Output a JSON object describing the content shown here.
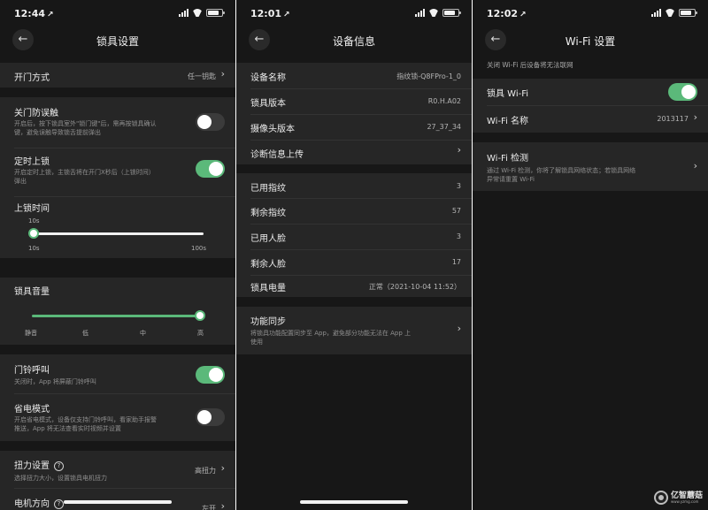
{
  "panel_lock_settings": {
    "status": {
      "time": "12:44",
      "location_arrow": "↗"
    },
    "nav": {
      "back": "←",
      "title": "锁具设置"
    },
    "unlock_method": {
      "label": "开门方式",
      "value": "任一钥匙"
    },
    "anti_mistouch": {
      "label": "关门防误触",
      "desc_line1": "开启后，按下锁具室外\"锁门键\"后，需再按锁具确认",
      "desc_line2": "键，避免误触导致锁舌提前弹出",
      "enabled": false
    },
    "timed_lock": {
      "label": "定时上锁",
      "desc_line1": "开启定时上锁，主锁舌将在开门X秒后（上锁时间）",
      "desc_line2": "弹出",
      "enabled": true
    },
    "lock_time": {
      "label": "上锁时间",
      "current": "10s",
      "min_label": "10s",
      "max_label": "100s",
      "fraction": 0.0
    },
    "volume": {
      "label": "锁具音量",
      "ticks": [
        "静音",
        "低",
        "中",
        "高"
      ],
      "fraction": 1.0
    },
    "doorbell": {
      "label": "门铃呼叫",
      "desc": "关闭时，App 将屏蔽门铃呼叫",
      "enabled": true
    },
    "power_saving": {
      "label": "省电模式",
      "desc_line1": "开启省电模式，设备仅支持门铃呼叫，看家助手报警",
      "desc_line2": "推送，App 将无法查看实时视频并设置",
      "enabled": false
    },
    "torque": {
      "label": "扭力设置",
      "help": "?",
      "desc": "选择扭力大小，设置锁具电机扭力",
      "value": "高扭力"
    },
    "motor_direction": {
      "label": "电机方向",
      "help": "?",
      "value": "左开"
    }
  },
  "panel_device_info": {
    "status": {
      "time": "12:01",
      "location_arrow": "↗"
    },
    "nav": {
      "back": "←",
      "title": "设备信息"
    },
    "rows_group1": [
      {
        "label": "设备名称",
        "value": "指纹锁-Q8FPro-1_0"
      },
      {
        "label": "锁具版本",
        "value": "R0.H.A02"
      },
      {
        "label": "摄像头版本",
        "value": "27_37_34"
      },
      {
        "label": "诊断信息上传",
        "value": ""
      }
    ],
    "rows_group2": [
      {
        "label": "已用指纹",
        "value": "3"
      },
      {
        "label": "剩余指纹",
        "value": "57"
      },
      {
        "label": "已用人脸",
        "value": "3"
      },
      {
        "label": "剩余人脸",
        "value": "17"
      },
      {
        "label": "锁具电量",
        "value": "正常（2021-10-04 11:52）"
      }
    ],
    "sync": {
      "label": "功能同步",
      "desc_line1": "将锁具功能配置同步至 App，避免部分功能无法在 App 上",
      "desc_line2": "使用"
    }
  },
  "panel_wifi": {
    "status": {
      "time": "12:02",
      "location_arrow": "↗"
    },
    "nav": {
      "back": "←",
      "title": "Wi-Fi 设置"
    },
    "note": "关闭 Wi-Fi 后设备将无法联网",
    "lock_wifi": {
      "label": "锁具 Wi-Fi",
      "enabled": true
    },
    "wifi_name": {
      "label": "Wi-Fi 名称",
      "value": "2013117"
    },
    "wifi_check": {
      "label": "Wi-Fi 检测",
      "desc_line1": "通过 Wi-Fi 检测，你将了解锁具网络状态；若锁具网络",
      "desc_line2": "异常请重置 Wi-Fi"
    }
  },
  "watermark": {
    "name": "亿智蘑菇",
    "sub": "www.yzmg.com"
  },
  "colors": {
    "accent": "#5bb97a",
    "panel_bg": "#171717",
    "row_bg": "#262626"
  }
}
